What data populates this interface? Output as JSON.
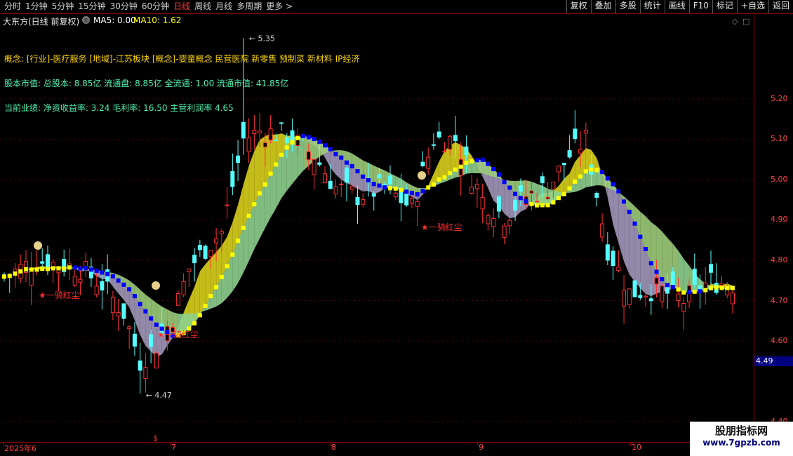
{
  "toolbar": {
    "tabs": [
      {
        "label": "分时",
        "active": false
      },
      {
        "label": "1分钟",
        "active": false
      },
      {
        "label": "5分钟",
        "active": false
      },
      {
        "label": "15分钟",
        "active": false
      },
      {
        "label": "30分钟",
        "active": false
      },
      {
        "label": "60分钟",
        "active": false
      },
      {
        "label": "日线",
        "active": true
      },
      {
        "label": "周线",
        "active": false
      },
      {
        "label": "月线",
        "active": false
      },
      {
        "label": "多周期",
        "active": false
      },
      {
        "label": "更多 >",
        "active": false
      }
    ],
    "right_buttons": [
      "复权",
      "叠加",
      "多股",
      "统计",
      "画线",
      "F10",
      "标记",
      "+自选",
      "返回"
    ]
  },
  "header": {
    "stock": "大东方(日线 前复权)",
    "ma_toggle_icon": "circle-arrow-icon",
    "ma5": "MA5: 0.00",
    "ma10": "MA10: 1.62"
  },
  "info": {
    "concept": "概念: [行业]-医疗服务 [地域]-江苏板块 [概念]-婴童概念 民营医院 新零售 预制菜 新材料 IP经济",
    "capital": "股本市值: 总股本: 8.85亿 流通盘: 8.85亿 全流通: 1.00 流通市值: 41.85亿",
    "performance": "当前业绩: 净资收益率: 3.24 毛利率: 16.50 主营利润率 4.65"
  },
  "chart_data": {
    "type": "candlestick",
    "ylim": [
      4.35,
      5.41
    ],
    "y_ticks": [
      "5.20",
      "5.10",
      "5.00",
      "4.90",
      "4.80",
      "4.70",
      "4.60",
      "4.40"
    ],
    "current_price": "4.49",
    "x_labels": [
      "2025年6",
      "7",
      "8",
      "9",
      "10"
    ],
    "high_label": "5.35",
    "low_label": "4.47",
    "annotations": [
      "★一骑红尘",
      "★一骑红尘",
      "★一骑红尘"
    ],
    "bottom_marker": "$",
    "colors": {
      "up": "#ff3030",
      "down": "#54ffff",
      "ma_fast": "#ffff00",
      "ma_slow": "#0000ff",
      "band_up_fill": "#cfc61a",
      "band_up_under": "#8ed08e",
      "band_down_fill": "#9a8fb0",
      "band_down_under": "#9ccc7a"
    }
  },
  "watermark": {
    "line1": "股朋指标网",
    "line2": "www.7gpzb.com"
  }
}
